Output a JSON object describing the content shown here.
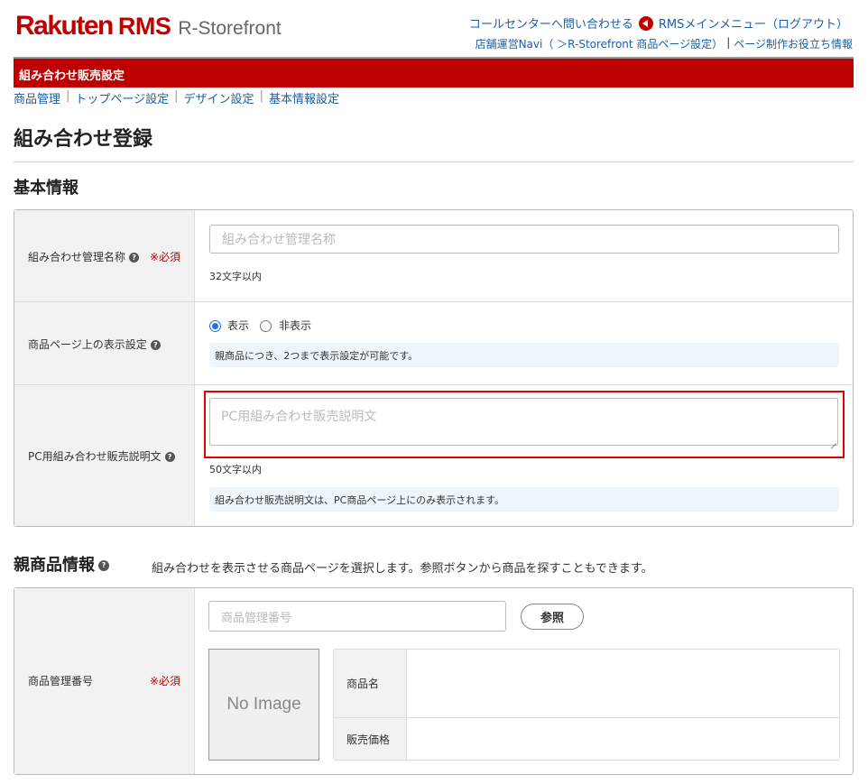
{
  "header": {
    "logo_rakuten": "Rakuten",
    "logo_rms": "RMS",
    "logo_product": "R-Storefront",
    "call_center": "コールセンターへ問い合わせる",
    "rms_menu": "RMSメインメニュー（",
    "logout": "ログアウト）",
    "navi": "店舗運営Navi（ ＞R-Storefront 商品ページ設定）",
    "sep": "|",
    "help": "ページ制作お役立ち情報"
  },
  "titlebar": {
    "title": "組み合わせ販売設定"
  },
  "subnav": {
    "items": [
      "商品管理",
      "トップページ設定",
      "デザイン設定",
      "基本情報設定"
    ],
    "sep": "|"
  },
  "page": {
    "title": "組み合わせ登録"
  },
  "basic": {
    "section_title": "基本情報",
    "name_label": "組み合わせ管理名称",
    "required": "※必須",
    "name_placeholder": "組み合わせ管理名称",
    "name_hint": "32文字以内",
    "display_label": "商品ページ上の表示設定",
    "radio_show": "表示",
    "radio_hide": "非表示",
    "display_note": "親商品につき、2つまで表示設定が可能です。",
    "desc_label": "PC用組み合わせ販売説明文",
    "desc_placeholder": "PC用組み合わせ販売説明文",
    "desc_hint": "50文字以内",
    "desc_note": "組み合わせ販売説明文は、PC商品ページ上にのみ表示されます。"
  },
  "parent": {
    "section_title": "親商品情報",
    "section_desc": "組み合わせを表示させる商品ページを選択します。参照ボタンから商品を探すこともできます。",
    "code_label": "商品管理番号",
    "required": "※必須",
    "code_placeholder": "商品管理番号",
    "ref_button": "参照",
    "no_image": "No Image",
    "product_name_label": "商品名",
    "price_label": "販売価格"
  },
  "colors": {
    "brand_red": "#bf0000",
    "link_blue": "#1a5ea8",
    "highlight_red": "#e60000",
    "note_bg": "#eef6fc"
  }
}
